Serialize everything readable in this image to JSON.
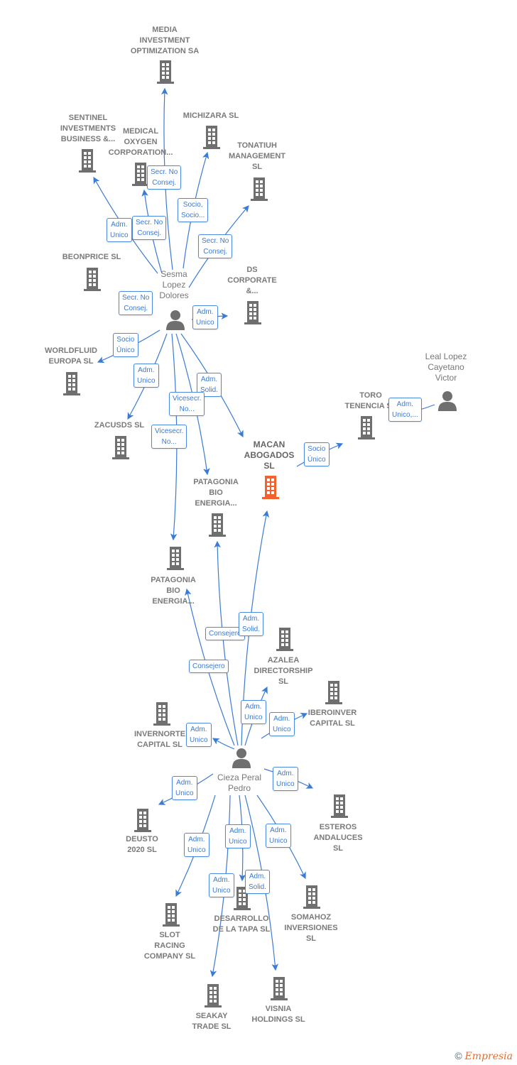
{
  "colors": {
    "company": "#6f6f6f",
    "focus_company": "#f0622e",
    "edge": "#3a7bd5",
    "person": "#6f6f6f"
  },
  "companies": {
    "media": "MEDIA\nINVESTMENT\nOPTIMIZATION SA",
    "sentinel": "SENTINEL\nINVESTMENTS\nBUSINESS &...",
    "medical": "MEDICAL\nOXYGEN\nCORPORATION...",
    "michizara": "MICHIZARA  SL",
    "tonatiuh": "TONATIUH\nMANAGEMENT\nSL",
    "beonprice": "BEONPRICE SL",
    "ds": "DS\nCORPORATE\n&...",
    "worldfluid": "WORLDFLUID\nEUROPA  SL",
    "zacusds": "ZACUSDS  SL",
    "toro": "TORO\nTENENCIA  SL",
    "macan": "MACAN\nABOGADOS\nSL",
    "patagonia1": "PATAGONIA\nBIO\nENERGIA...",
    "patagonia2": "PATAGONIA\nBIO\nENERGIA...",
    "azalea": "AZALEA\nDIRECTORSHIP\nSL",
    "iberoinver": "IBEROINVER\nCAPITAL  SL",
    "invernorte": "INVERNORTE\nCAPITAL  SL",
    "deusto": "DEUSTO\n2020  SL",
    "esteros": "ESTEROS\nANDALUCES\nSL",
    "slot": "SLOT\nRACING\nCOMPANY SL",
    "desarrollo": "DESARROLLO\nDE LA TAPA  SL",
    "somahoz": "SOMAHOZ\nINVERSIONES\nSL",
    "seakay": "SEAKAY\nTRADE  SL",
    "visnia": "VISNIA\nHOLDINGS  SL"
  },
  "persons": {
    "sesma": "Sesma\nLopez\nDolores",
    "leal": "Leal Lopez\nCayetano\nVictor",
    "cieza": "Cieza Peral\nPedro"
  },
  "edge_labels": [
    "Secr.  No\nConsej.",
    "Adm.\nUnico",
    "Secr.  No\nConsej.",
    "Socio,\nSocio...",
    "Secr.  No\nConsej.",
    "Secr.  No\nConsej.",
    "Adm.\nUnico",
    "Socio\nÚnico",
    "Adm.\nUnico",
    "Adm.\nSolid.",
    "Vicesecr.\nNo...",
    "Vicesecr.\nNo...",
    "Adm.\nUnico,...",
    "Socio\nÚnico",
    "Adm.\nSolid.",
    "Consejero",
    "Consejero",
    "Adm.\nUnico",
    "Adm.\nUnico",
    "Adm.\nUnico",
    "Adm.\nUnico",
    "Adm.\nUnico",
    "Adm.\nUnico",
    "Adm.\nUnico",
    "Adm.\nUnico",
    "Adm.\nSolid.",
    "Adm.\nUnico"
  ],
  "footer": {
    "copyright": "©",
    "brand": "Empresia"
  }
}
